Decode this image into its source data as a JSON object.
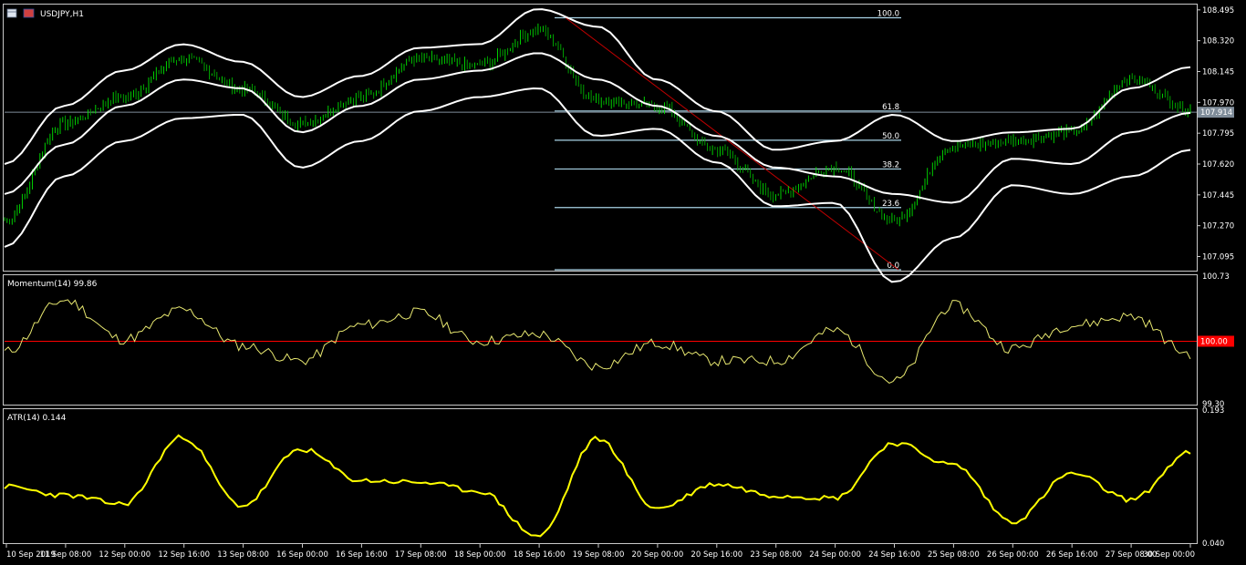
{
  "window": {
    "title": "USDJPY,H1"
  },
  "colors": {
    "background": "#000000",
    "bull_candle": "#00e600",
    "bands": "#ffffff",
    "fib": "#a9d3e6",
    "momentum": "#e8e870",
    "atr": "#ffff00",
    "level_line": "#ff0000",
    "current_price_line": "#7f8c99"
  },
  "price_panel": {
    "symbol_label": "USDJPY,H1",
    "y_ticks": [
      "108.495",
      "108.320",
      "108.145",
      "107.970",
      "107.795",
      "107.620",
      "107.445",
      "107.270",
      "107.095"
    ],
    "current_price": "107.914",
    "fib_levels": [
      {
        "label": "100.0",
        "price": 108.45
      },
      {
        "label": "61.8",
        "price": 107.921
      },
      {
        "label": "50.0",
        "price": 107.755
      },
      {
        "label": "38.2",
        "price": 107.592
      },
      {
        "label": "23.6",
        "price": 107.373
      },
      {
        "label": "0.0",
        "price": 107.02
      }
    ]
  },
  "momentum_panel": {
    "label": "Momentum(14) 99.86",
    "y_ticks": [
      "100.73",
      "99.30"
    ],
    "level_label": "100.00"
  },
  "atr_panel": {
    "label": "ATR(14) 0.144",
    "y_ticks": [
      "0.193",
      "0.040"
    ]
  },
  "x_labels": [
    "10 Sep 2019",
    "11 Sep 08:00",
    "12 Sep 00:00",
    "12 Sep 16:00",
    "13 Sep 08:00",
    "16 Sep 00:00",
    "16 Sep 16:00",
    "17 Sep 08:00",
    "18 Sep 00:00",
    "18 Sep 16:00",
    "19 Sep 08:00",
    "20 Sep 00:00",
    "20 Sep 16:00",
    "23 Sep 08:00",
    "24 Sep 00:00",
    "24 Sep 16:00",
    "25 Sep 08:00",
    "26 Sep 00:00",
    "26 Sep 16:00",
    "27 Sep 08:00",
    "30 Sep 00:00"
  ],
  "chart_data": [
    {
      "type": "line",
      "title": "USDJPY,H1",
      "ylim": [
        107.02,
        108.52
      ],
      "x": [
        "10 Sep 2019",
        "11 Sep 08:00",
        "12 Sep 00:00",
        "12 Sep 16:00",
        "13 Sep 08:00",
        "16 Sep 00:00",
        "16 Sep 16:00",
        "17 Sep 08:00",
        "18 Sep 00:00",
        "18 Sep 16:00",
        "19 Sep 08:00",
        "20 Sep 00:00",
        "20 Sep 16:00",
        "23 Sep 08:00",
        "24 Sep 00:00",
        "24 Sep 16:00",
        "25 Sep 08:00",
        "26 Sep 00:00",
        "26 Sep 16:00",
        "27 Sep 08:00",
        "30 Sep 00:00"
      ],
      "series": [
        {
          "values": [
            107.3,
            107.85,
            108.0,
            108.22,
            108.05,
            107.85,
            108.0,
            108.22,
            108.18,
            108.38,
            107.98,
            107.95,
            107.7,
            107.45,
            107.6,
            107.3,
            107.72,
            107.75,
            107.8,
            108.1,
            107.93
          ]
        },
        {
          "values": [
            107.45,
            107.73,
            107.95,
            108.1,
            108.05,
            107.8,
            107.95,
            108.1,
            108.15,
            108.25,
            108.1,
            107.95,
            107.78,
            107.6,
            107.55,
            107.45,
            107.4,
            107.65,
            107.62,
            107.8,
            107.91
          ]
        },
        {
          "values": [
            107.62,
            107.95,
            108.15,
            108.3,
            108.2,
            108.0,
            108.12,
            108.28,
            108.3,
            108.5,
            108.4,
            108.1,
            107.92,
            107.7,
            107.75,
            107.9,
            107.75,
            107.8,
            107.82,
            108.05,
            108.17
          ]
        },
        {
          "values": [
            107.15,
            107.55,
            107.75,
            107.88,
            107.9,
            107.6,
            107.75,
            107.92,
            108.0,
            108.05,
            107.78,
            107.82,
            107.63,
            107.38,
            107.4,
            106.95,
            107.2,
            107.5,
            107.45,
            107.55,
            107.7
          ]
        }
      ]
    },
    {
      "type": "line",
      "title": "Momentum(14) 99.86",
      "ylim": [
        99.3,
        100.73
      ],
      "x": [
        "10 Sep 2019",
        "11 Sep 08:00",
        "12 Sep 00:00",
        "12 Sep 16:00",
        "13 Sep 08:00",
        "16 Sep 00:00",
        "16 Sep 16:00",
        "17 Sep 08:00",
        "18 Sep 00:00",
        "18 Sep 16:00",
        "19 Sep 08:00",
        "20 Sep 00:00",
        "20 Sep 16:00",
        "23 Sep 08:00",
        "24 Sep 00:00",
        "24 Sep 16:00",
        "25 Sep 08:00",
        "26 Sep 00:00",
        "26 Sep 16:00",
        "27 Sep 08:00",
        "30 Sep 00:00"
      ],
      "series": [
        {
          "values": [
            99.88,
            100.46,
            100.02,
            100.35,
            99.95,
            99.78,
            100.18,
            100.32,
            100.0,
            100.08,
            99.72,
            99.98,
            99.78,
            99.78,
            100.12,
            99.55,
            100.4,
            99.92,
            100.18,
            100.28,
            99.86
          ]
        }
      ]
    },
    {
      "type": "line",
      "title": "ATR(14) 0.144",
      "ylim": [
        0.04,
        0.193
      ],
      "x": [
        "10 Sep 2019",
        "11 Sep 08:00",
        "12 Sep 00:00",
        "12 Sep 16:00",
        "13 Sep 08:00",
        "16 Sep 00:00",
        "16 Sep 16:00",
        "17 Sep 08:00",
        "18 Sep 00:00",
        "18 Sep 16:00",
        "19 Sep 08:00",
        "20 Sep 00:00",
        "20 Sep 16:00",
        "23 Sep 08:00",
        "24 Sep 00:00",
        "24 Sep 16:00",
        "25 Sep 08:00",
        "26 Sep 00:00",
        "26 Sep 16:00",
        "27 Sep 08:00",
        "30 Sep 00:00"
      ],
      "series": [
        {
          "values": [
            0.105,
            0.095,
            0.085,
            0.162,
            0.083,
            0.148,
            0.112,
            0.11,
            0.1,
            0.048,
            0.16,
            0.08,
            0.108,
            0.095,
            0.092,
            0.155,
            0.13,
            0.065,
            0.12,
            0.09,
            0.144
          ]
        }
      ]
    }
  ]
}
